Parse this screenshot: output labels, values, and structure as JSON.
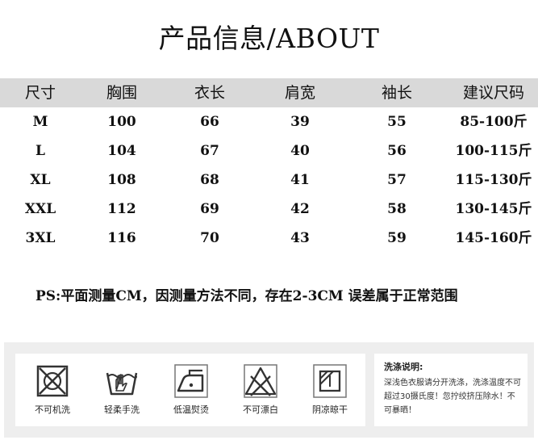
{
  "title": "产品信息/ABOUT",
  "table": {
    "headers": [
      "尺寸",
      "胸围",
      "衣长",
      "肩宽",
      "袖长",
      "建议尺码"
    ],
    "rows": [
      [
        "M",
        "100",
        "66",
        "39",
        "55",
        "85-100斤"
      ],
      [
        "L",
        "104",
        "67",
        "40",
        "56",
        "100-115斤"
      ],
      [
        "XL",
        "108",
        "68",
        "41",
        "57",
        "115-130斤"
      ],
      [
        "XXL",
        "112",
        "69",
        "42",
        "58",
        "130-145斤"
      ],
      [
        "3XL",
        "116",
        "70",
        "43",
        "59",
        "145-160斤"
      ]
    ]
  },
  "note": "PS:平面测量CM，因测量方法不同，存在2-3CM 误差属于正常范围",
  "care": {
    "items": [
      {
        "label": "不可机洗",
        "icon": "no-machine-wash-icon"
      },
      {
        "label": "轻柔手洗",
        "icon": "hand-wash-icon"
      },
      {
        "label": "低温熨烫",
        "icon": "low-temp-iron-icon"
      },
      {
        "label": "不可漂白",
        "icon": "no-bleach-icon"
      },
      {
        "label": "阴凉晾干",
        "icon": "shade-dry-icon"
      }
    ],
    "instructions_title": "洗涤说明:",
    "instructions_text": "深浅色衣服请分开洗涤，洗涤温度不可超过30摄氏度！忽拧绞挤压除水！不可暴晒！"
  },
  "colors": {
    "header_bg": "#d9d9d9",
    "care_panel_bg": "#eeeeee",
    "text": "#111111"
  }
}
